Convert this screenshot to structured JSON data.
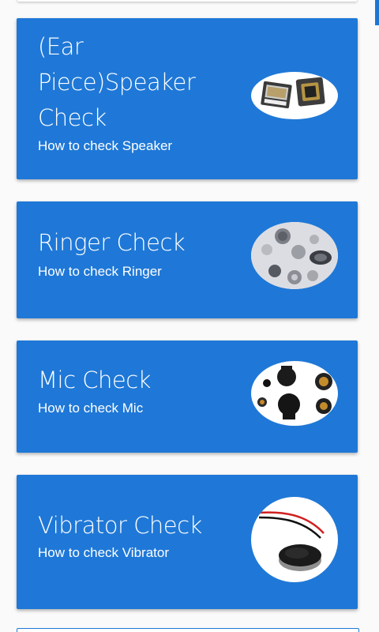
{
  "cards": [
    {
      "title": "(Ear Piece)Speaker Check",
      "subtitle": "How to check Speaker",
      "image_icon": "ear-speaker-icon"
    },
    {
      "title": "Ringer Check",
      "subtitle": "How to check Ringer",
      "image_icon": "ringer-icon"
    },
    {
      "title": "Mic Check",
      "subtitle": "How to check Mic",
      "image_icon": "mic-icon"
    },
    {
      "title": "Vibrator Check",
      "subtitle": "How to check Vibrator",
      "image_icon": "vibrator-motor-icon"
    }
  ],
  "colors": {
    "card_background": "#1f78d7",
    "card_text": "#ffffff",
    "scroll_indicator": "#1e76d4"
  }
}
